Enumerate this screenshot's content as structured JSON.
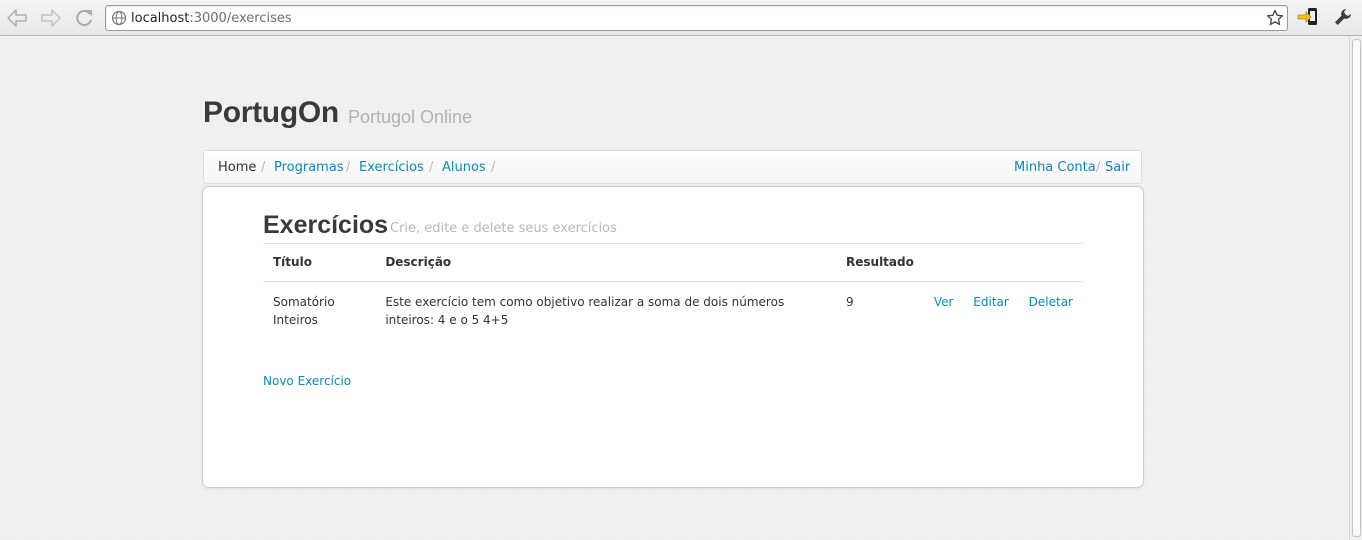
{
  "browser": {
    "url_host": "localhost",
    "url_path": ":3000/exercises"
  },
  "header": {
    "brand": "PortugOn",
    "tagline": "Portugol Online"
  },
  "breadcrumb": {
    "items": [
      {
        "label": "Home",
        "active": true
      },
      {
        "label": "Programas"
      },
      {
        "label": "Exercícios"
      },
      {
        "label": "Alunos"
      }
    ],
    "separator": "/",
    "account_label": "Minha Conta",
    "logout_label": "Sair"
  },
  "main": {
    "title": "Exercícios",
    "subtitle": "Crie, edite e delete seus exercícios",
    "table": {
      "columns": [
        "Título",
        "Descrição",
        "Resultado"
      ],
      "rows": [
        {
          "title": "Somatório Inteiros",
          "description": "Este exercício tem como objetivo realizar a soma de dois números inteiros: 4 e o 5 4+5",
          "result": "9",
          "actions": {
            "view": "Ver",
            "edit": "Editar",
            "delete": "Deletar"
          }
        }
      ]
    },
    "new_link": "Novo Exercício"
  },
  "colors": {
    "link": "#0a89b8",
    "heading": "#3a3a3a",
    "muted": "#b8b8b8"
  },
  "icons": [
    "back-arrow-icon",
    "forward-arrow-icon",
    "reload-icon",
    "globe-icon",
    "star-icon",
    "extension-icon",
    "wrench-icon"
  ]
}
